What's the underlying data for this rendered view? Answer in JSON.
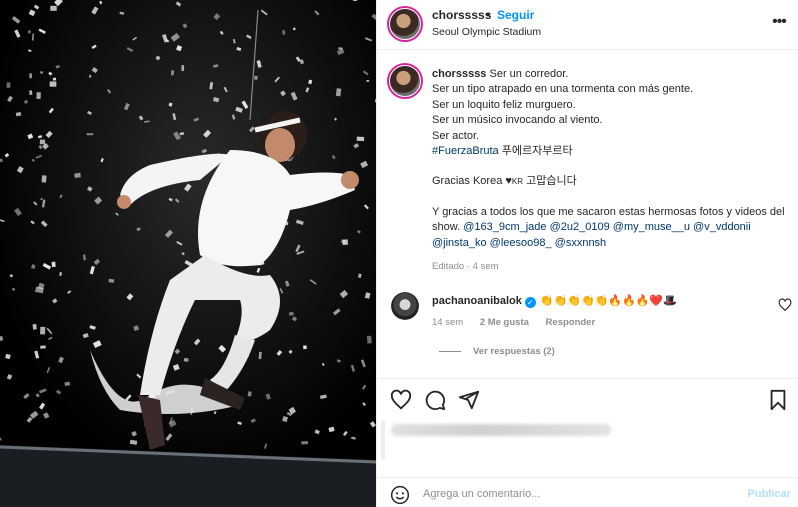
{
  "header": {
    "username": "chorsssss",
    "dot": "•",
    "follow_label": "Seguir",
    "location": "Seoul Olympic Stadium",
    "more_label": "•••"
  },
  "caption": {
    "username": "chorsssss",
    "line1": "Ser un corredor.",
    "line2": "Ser un tipo atrapado en una tormenta con más gente.",
    "line3": "Ser un loquito feliz murguero.",
    "line4": "Ser un músico invocando al viento.",
    "line5": "Ser actor.",
    "hashtag": "#FuerzaBruta",
    "hashtag_ko": "푸에르자부르타",
    "thanks": "Gracias Korea ♥",
    "kr": "KR",
    "thanks_ko": "고맙습니다",
    "thanks2": "Y gracias a todos los que me sacaron estas hermosas fotos y videos del show.",
    "mention1": "@163_9cm_jade",
    "mention2": "@2u2_0109",
    "mention3": "@my_muse__u",
    "mention4": "@v_vddonii",
    "mention5": "@jinsta_ko",
    "mention6": "@leesoo98_",
    "mention7": "@sxxnnsh",
    "meta": "Editado · 4 sem"
  },
  "comment": {
    "username": "pachanoanibalok",
    "verified": "✓",
    "text": "👏👏👏👏👏🔥🔥🔥❤️🎩",
    "time": "14 sem",
    "likes": "2 Me gusta",
    "reply": "Responder",
    "view_replies": "Ver respuestas (2)"
  },
  "composer": {
    "placeholder": "Agrega un comentario...",
    "publish": "Publicar"
  },
  "icons": {
    "like": "heart-icon",
    "comment": "comment-icon",
    "share": "send-icon",
    "save": "bookmark-icon",
    "emoji": "smiley-icon"
  },
  "colors": {
    "accent": "#0095f6",
    "link": "#00376b",
    "muted": "#8e8e8e",
    "publish_disabled": "#b2dffc"
  }
}
